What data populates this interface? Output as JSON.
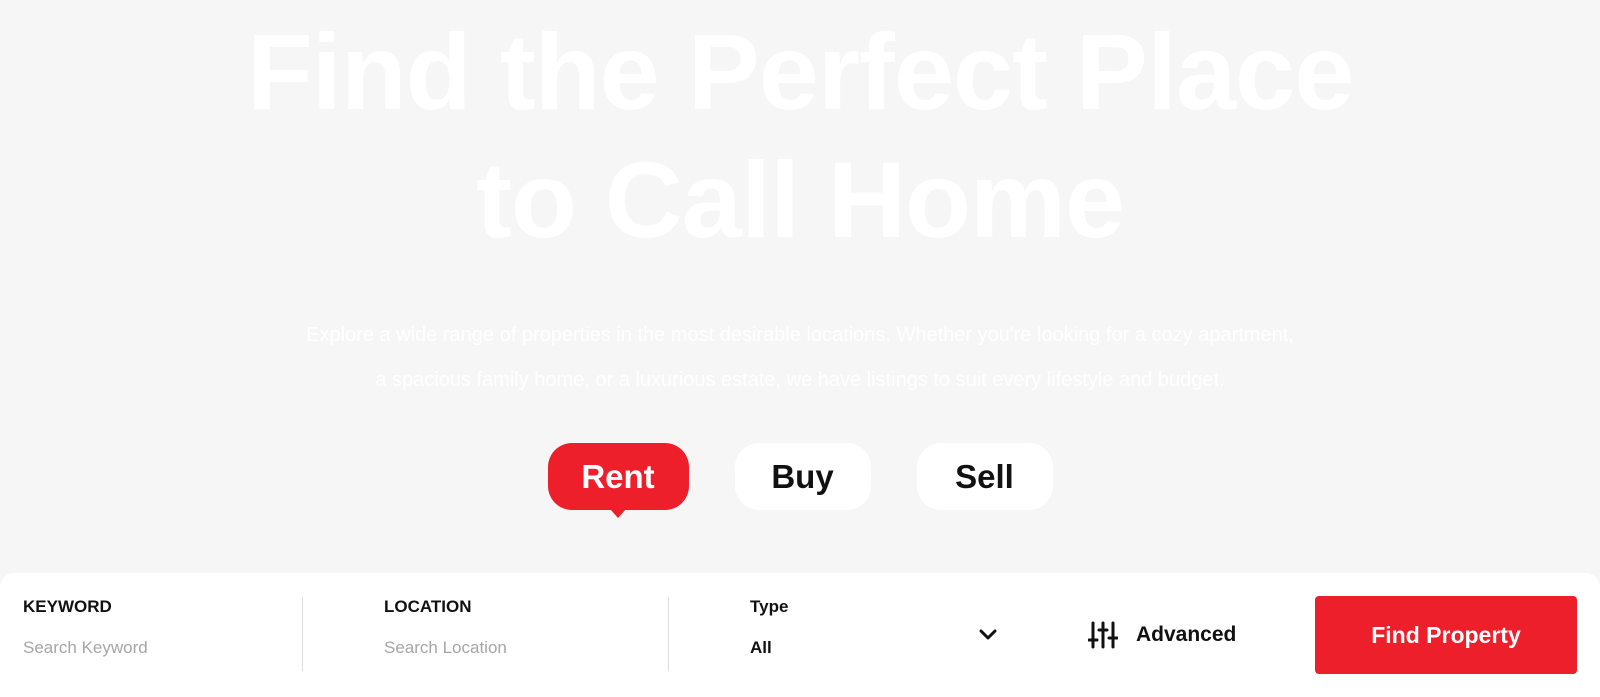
{
  "hero": {
    "title_line1": "Find the Perfect Place",
    "title_line2": "to Call Home",
    "desc_line1": "Explore a wide range of properties in the most desirable locations. Whether you're looking for a cozy apartment,",
    "desc_line2": "a spacious family home, or a luxurious estate, we have listings to suit every lifestyle and budget."
  },
  "tabs": [
    {
      "label": "Rent",
      "active": true
    },
    {
      "label": "Buy",
      "active": false
    },
    {
      "label": "Sell",
      "active": false
    }
  ],
  "search": {
    "keyword": {
      "label": "KEYWORD",
      "placeholder": "Search Keyword"
    },
    "location": {
      "label": "LOCATION",
      "placeholder": "Search Location"
    },
    "type": {
      "label": "Type",
      "value": "All"
    },
    "advanced_label": "Advanced",
    "find_label": "Find Property"
  },
  "colors": {
    "accent": "#ec1f2b",
    "background": "#f6f6f6"
  },
  "icons": {
    "type_dropdown": "chevron-down-icon",
    "advanced": "sliders-icon"
  }
}
